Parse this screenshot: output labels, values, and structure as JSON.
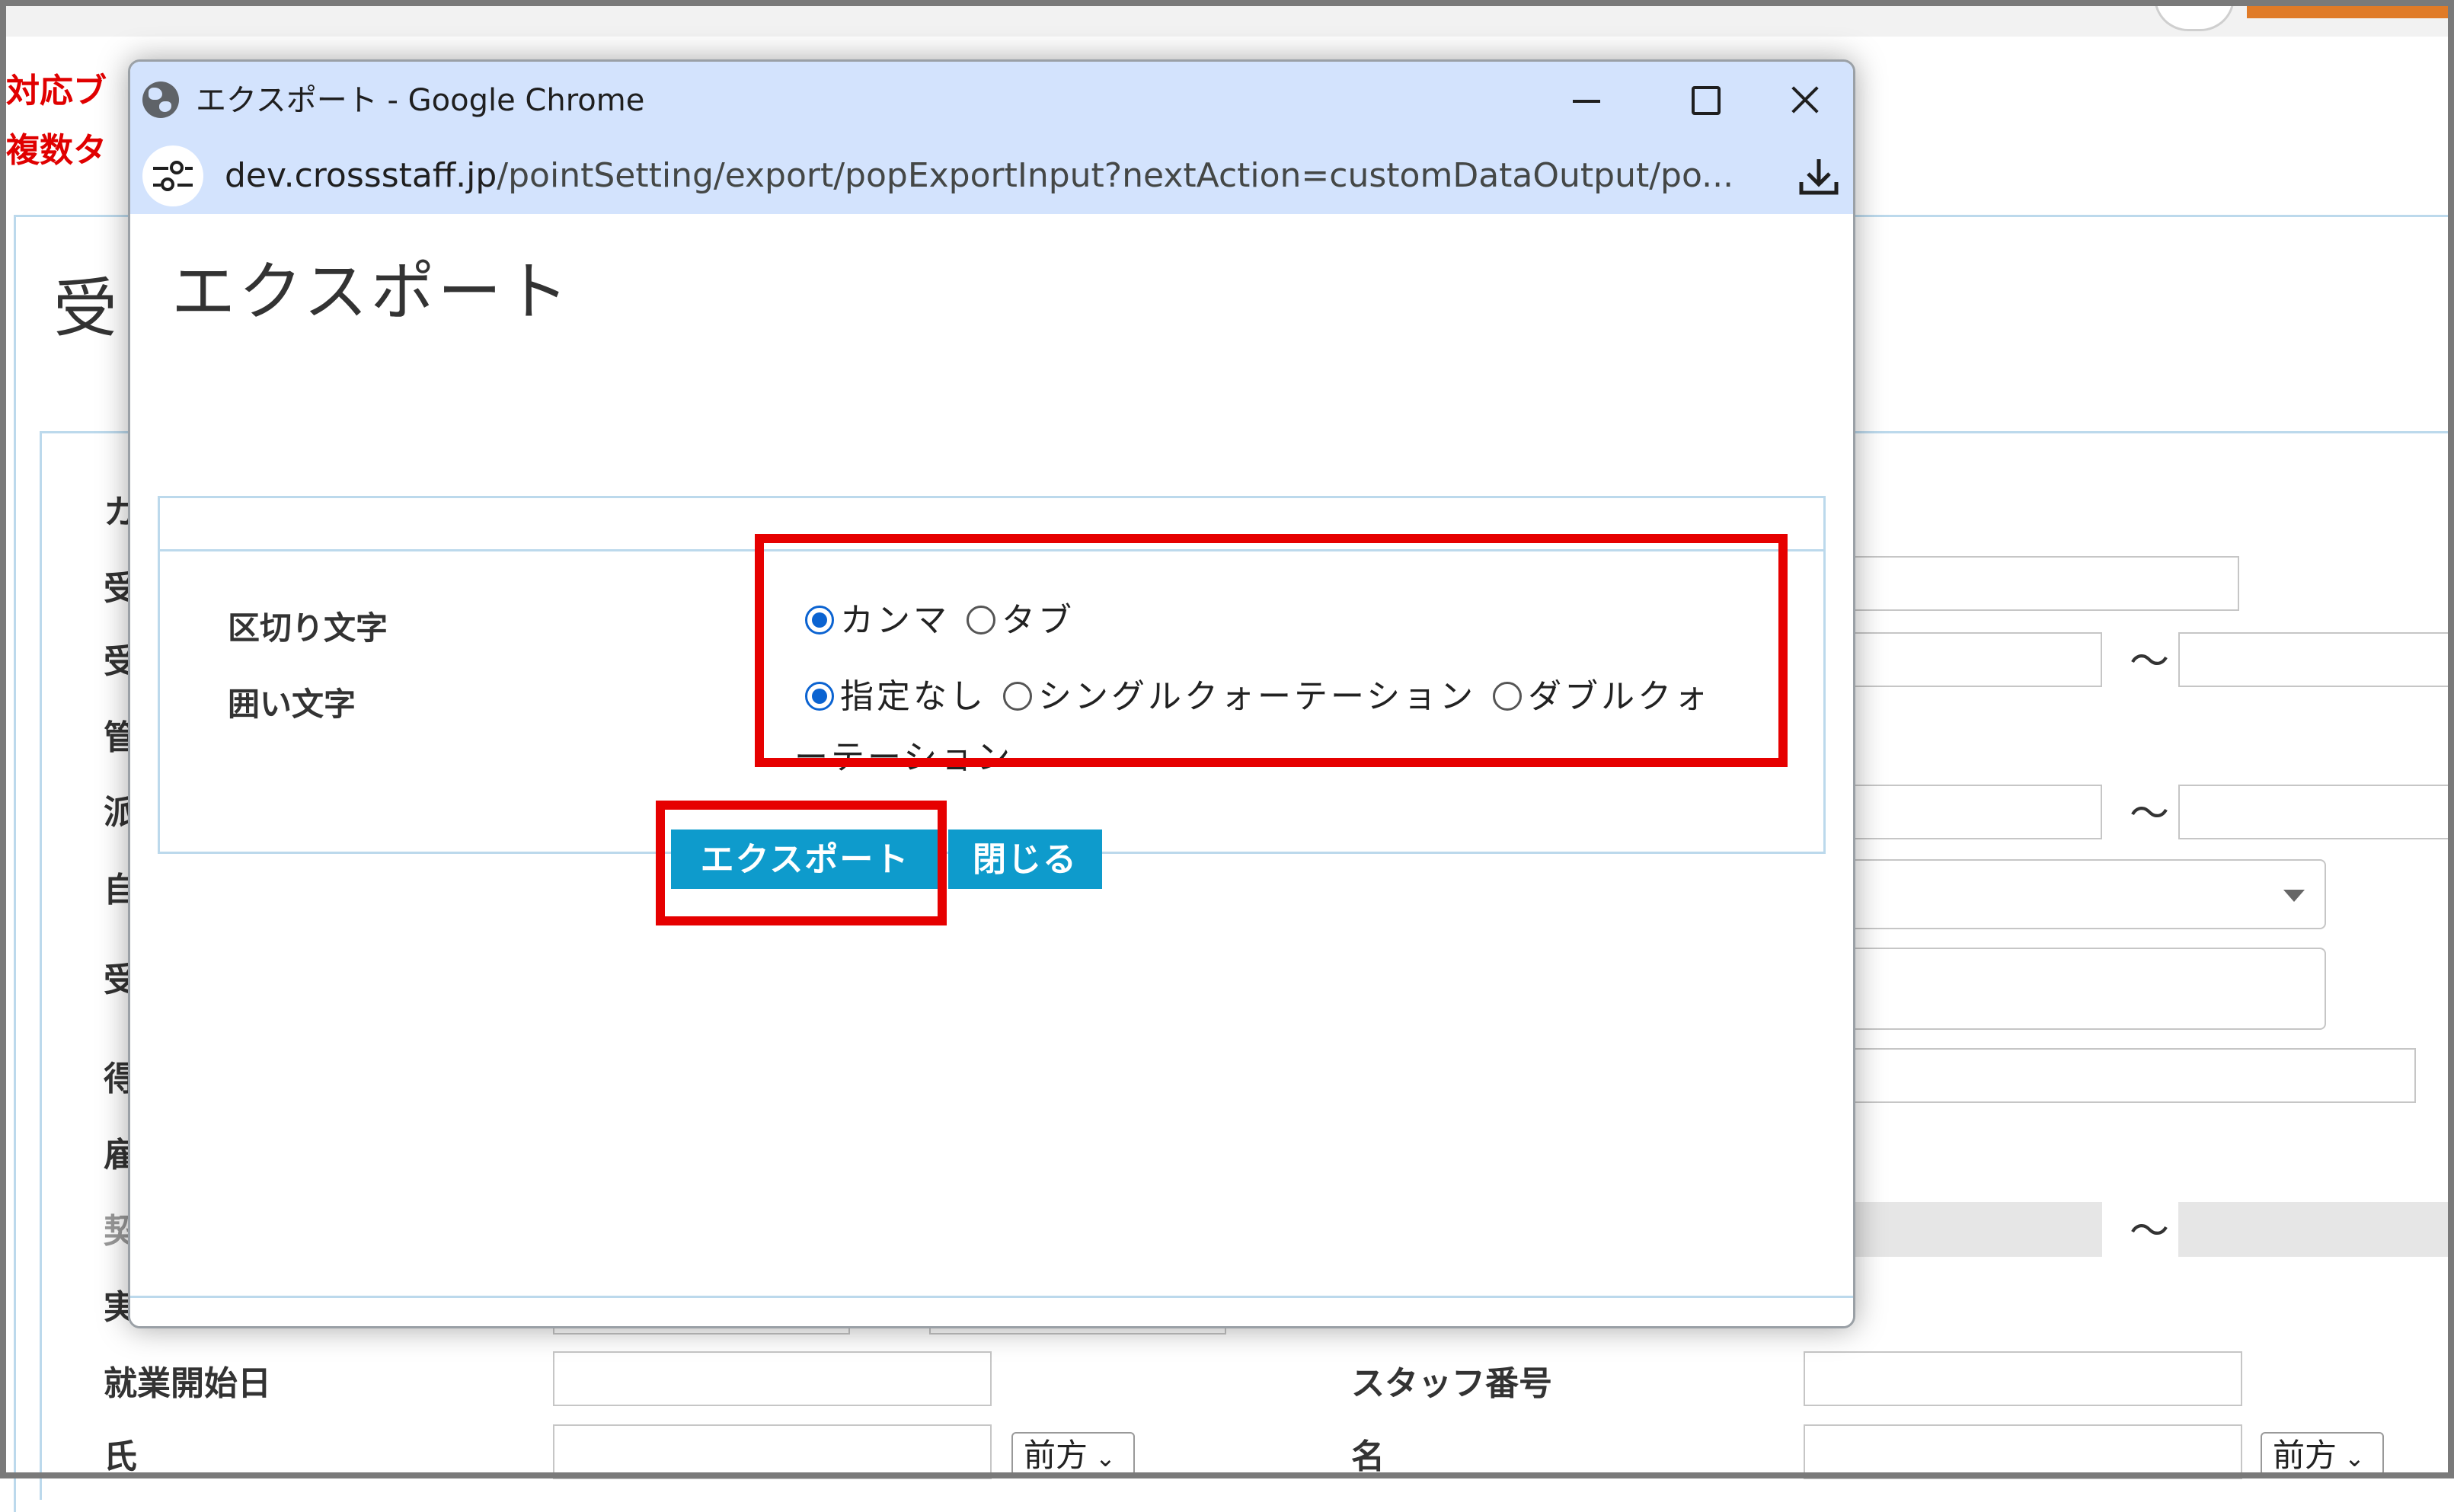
{
  "background": {
    "notes": [
      "対応ブ",
      "複数タ"
    ],
    "page_title": "受",
    "form_labels": [
      "カ",
      "受",
      "受",
      "管",
      "派",
      "自",
      "受",
      "得",
      "雇",
      "契",
      "実"
    ],
    "work_start_label": "就業開始日",
    "staff_number_label": "スタッフ番号",
    "last_name_label": "氏",
    "first_name_label": "名",
    "tilde": "〜",
    "name_order_left": "前方",
    "name_order_right": "前方"
  },
  "popup": {
    "window_title": "エクスポート - Google Chrome",
    "url": {
      "domain": "dev.crossstaff.jp",
      "path": "/pointSetting/export/popExportInput?nextAction=customDataOutput/po..."
    },
    "heading": "エクスポート",
    "delimiter": {
      "label": "区切り文字",
      "options": [
        {
          "label": "カンマ",
          "checked": true
        },
        {
          "label": "タブ",
          "checked": false
        }
      ]
    },
    "enclosure": {
      "label": "囲い文字",
      "options": [
        {
          "label": "指定なし",
          "checked": true
        },
        {
          "label": "シングルクォーテーション",
          "checked": false
        },
        {
          "label": "ダブルクォ",
          "checked": false
        }
      ],
      "wrap_text": "ーテーション"
    },
    "export_button": "エクスポート",
    "close_button": "閉じる"
  },
  "colors": {
    "highlight": "#e60000",
    "button": "#0e9bcc",
    "titlebar": "#d3e3fd",
    "radio_checked": "#0b63d1"
  }
}
